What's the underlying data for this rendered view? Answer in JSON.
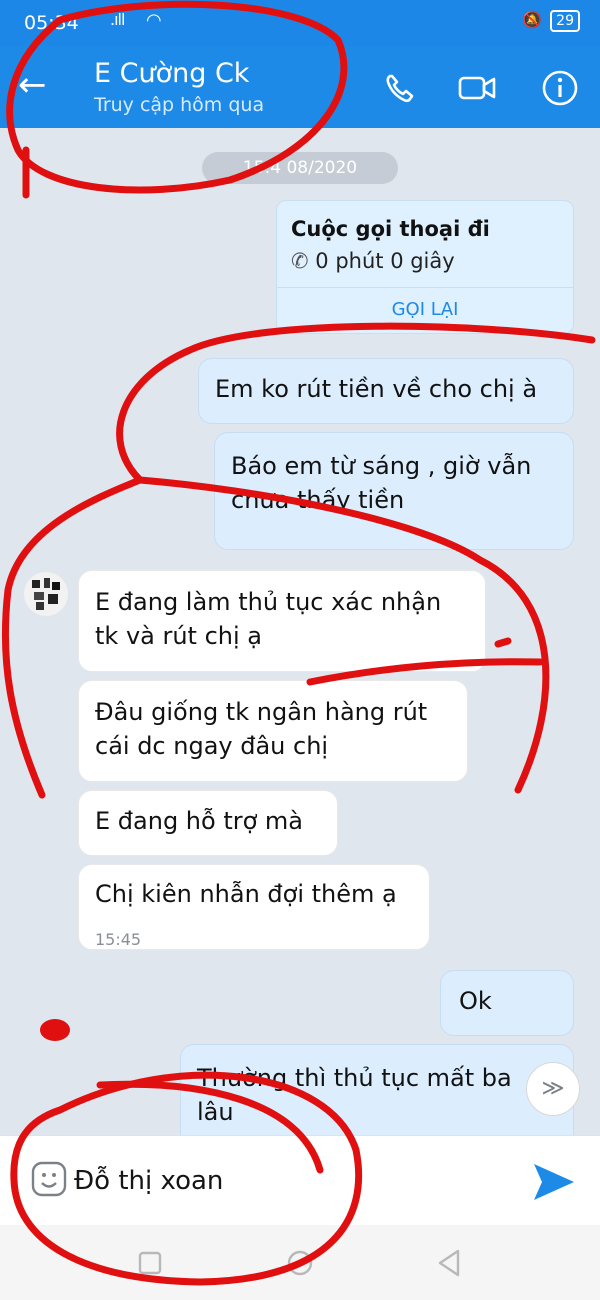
{
  "status_bar": {
    "time": "05:34",
    "battery": "29"
  },
  "header": {
    "title": "E Cường Ck",
    "subtitle": "Truy cập hôm qua"
  },
  "chat": {
    "date_separator": "15:4  08/2020",
    "call_card": {
      "title": "Cuộc gọi thoại đi",
      "duration": "0 phút 0 giây",
      "callback_label": "GỌI LẠI"
    },
    "messages": [
      {
        "side": "out",
        "text": "Em ko rút tiền về cho chị à"
      },
      {
        "side": "out",
        "text": "Báo em từ sáng , giờ vẫn\nchưa thấy tiền"
      },
      {
        "side": "in",
        "text": "E đang làm thủ tục xác nhận\ntk và rút chị ạ"
      },
      {
        "side": "in",
        "text": "Đâu giống tk ngân hàng rút\ncái dc ngay đâu chị"
      },
      {
        "side": "in",
        "text": "E đang hỗ trợ mà"
      },
      {
        "side": "in",
        "text": "Chị kiên nhẫn đợi thêm ạ",
        "time": "15:45"
      },
      {
        "side": "out",
        "text": "Ok"
      },
      {
        "side": "out",
        "text": "Thường thì thủ tục mất ba\nlâu"
      }
    ]
  },
  "composer": {
    "value": "Đỗ thị xoan"
  },
  "icons": {
    "back": "back-arrow-icon",
    "call": "phone-icon",
    "video": "video-camera-icon",
    "info": "info-icon",
    "emoji": "emoji-icon",
    "send": "send-icon",
    "scroll": "chevron-double-down-icon"
  },
  "colors": {
    "accent": "#1e8ae8",
    "out_bubble": "#dcedfd",
    "in_bubble": "#ffffff",
    "annotation": "#e01010"
  }
}
